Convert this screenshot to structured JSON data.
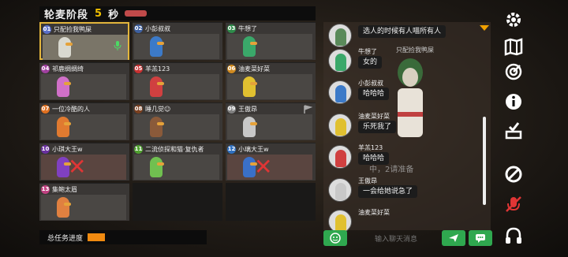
{
  "header": {
    "title": "轮麦阶段",
    "seconds": "5",
    "unit": "秒"
  },
  "players": [
    {
      "num": "01",
      "name": "只配捡我鸭屎",
      "badge": "#5a6fc8",
      "body": "#d9d9d0",
      "selected": true,
      "dead": false,
      "mic": true
    },
    {
      "num": "02",
      "name": "小彭叔叔",
      "badge": "#3c5fa0",
      "body": "#3c7ac8",
      "selected": false,
      "dead": false
    },
    {
      "num": "03",
      "name": "牛想了",
      "badge": "#2e8b4a",
      "body": "#3aa86a",
      "selected": false,
      "dead": false
    },
    {
      "num": "04",
      "name": "祁鹿绸绸绮",
      "badge": "#a040a0",
      "body": "#d070c8",
      "selected": false,
      "dead": false
    },
    {
      "num": "05",
      "name": "羊羔123",
      "badge": "#c83030",
      "body": "#d04040",
      "selected": false,
      "dead": false
    },
    {
      "num": "06",
      "name": "油麦菜好菜",
      "badge": "#d08a20",
      "body": "#e0c030",
      "selected": false,
      "dead": false
    },
    {
      "num": "07",
      "name": "一位冷酷的人",
      "badge": "#e07020",
      "body": "#e07a30",
      "selected": false,
      "dead": false
    },
    {
      "num": "08",
      "name": "睡几觉☺",
      "badge": "#7a4020",
      "body": "#8a5a3a",
      "selected": false,
      "dead": false
    },
    {
      "num": "09",
      "name": "王傲昂",
      "badge": "#808080",
      "body": "#c8c8c8",
      "selected": false,
      "dead": false,
      "flag": true
    },
    {
      "num": "10",
      "name": "小琪大王w",
      "badge": "#6a30a0",
      "body": "#8040c0",
      "selected": false,
      "dead": true
    },
    {
      "num": "11",
      "name": "二流侦探和猫·复仇者",
      "badge": "#50a030",
      "body": "#70c050",
      "selected": false,
      "dead": false
    },
    {
      "num": "12",
      "name": "小璃大王w",
      "badge": "#3070c0",
      "body": "#3a70c8",
      "selected": false,
      "dead": true
    },
    {
      "num": "13",
      "name": "集鲍太眉",
      "badge": "#c04080",
      "body": "#e08040",
      "selected": false,
      "dead": false
    }
  ],
  "task": {
    "label": "总任务进度",
    "progress": 0.2
  },
  "chat": {
    "messages": [
      {
        "name": "",
        "text": "选人的时候有人喵所有人",
        "avatar": "#5a8a5a"
      },
      {
        "name": "牛想了",
        "text": "女的",
        "avatar": "#3aa86a"
      },
      {
        "name": "小彭叔叔",
        "text": "哈哈哈",
        "avatar": "#3c7ac8"
      },
      {
        "name": "油麦菜好菜",
        "text": "乐死我了",
        "avatar": "#e0c030"
      },
      {
        "name": "羊羔123",
        "text": "哈哈哈",
        "avatar": "#d04040"
      },
      {
        "name": "王傲昂",
        "text": "一会给她说急了",
        "avatar": "#c8c8c8"
      },
      {
        "name": "油麦菜好菜",
        "text": "",
        "avatar": "#e0c030"
      }
    ],
    "overlay_name": "只配捡我鸭屎",
    "overlay_note": "中，2请准备",
    "placeholder": "输入聊天消息",
    "send_icon": "send-icon",
    "emoji_icon": "emoji-icon",
    "quick_icon": "quick-chat-icon"
  },
  "sidebar": [
    "settings-icon",
    "map-icon",
    "target-icon",
    "info-icon",
    "vote-icon",
    "block-icon",
    "mic-off-icon",
    "headphones-icon"
  ],
  "colors": {
    "accent": "#e2b53c",
    "green": "#2fa84f",
    "red": "#e03535"
  }
}
